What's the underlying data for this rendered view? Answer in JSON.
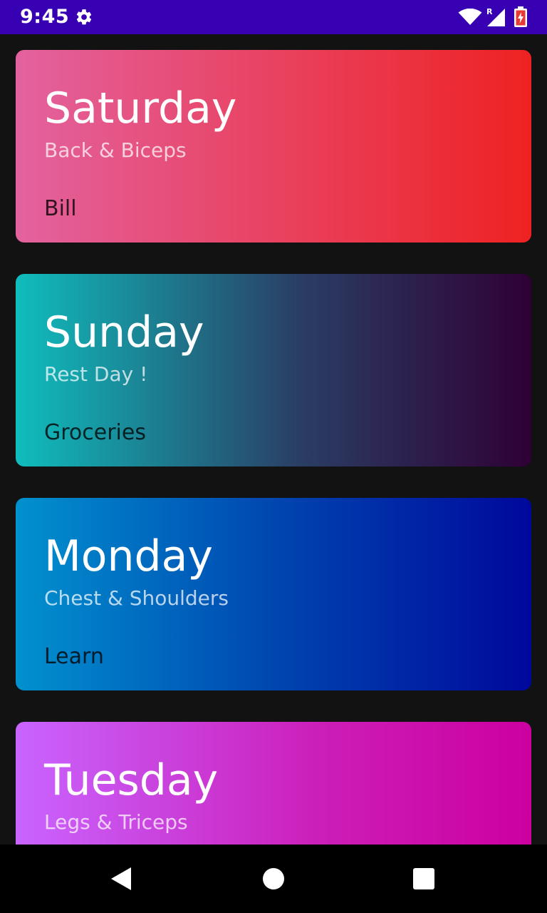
{
  "status_bar": {
    "time": "9:45",
    "signal_badge": "R",
    "icons": [
      "gear-icon",
      "wifi-icon",
      "cell-signal-icon",
      "battery-icon"
    ],
    "background_color": "#3700b3"
  },
  "cards": [
    {
      "day": "Saturday",
      "subtitle": "Back & Biceps",
      "label": "Bill",
      "gradient": [
        "#e3629f",
        "#ee2222"
      ]
    },
    {
      "day": "Sunday",
      "subtitle": "Rest Day !",
      "label": "Groceries",
      "gradient": [
        "#0fbdbd",
        "#2a3e64",
        "#2f0035"
      ]
    },
    {
      "day": "Monday",
      "subtitle": "Chest & Shoulders",
      "label": "Learn",
      "gradient": [
        "#0191cf",
        "#0046b0",
        "#00089c"
      ]
    },
    {
      "day": "Tuesday",
      "subtitle": "Legs & Triceps",
      "label": "",
      "gradient": [
        "#c964ff",
        "#cc1db8",
        "#cc00a0"
      ]
    }
  ],
  "nav_bar": {
    "icons": [
      "back-icon",
      "home-icon",
      "recents-icon"
    ]
  },
  "colors": {
    "background": "#121212",
    "nav_background": "#000000"
  }
}
